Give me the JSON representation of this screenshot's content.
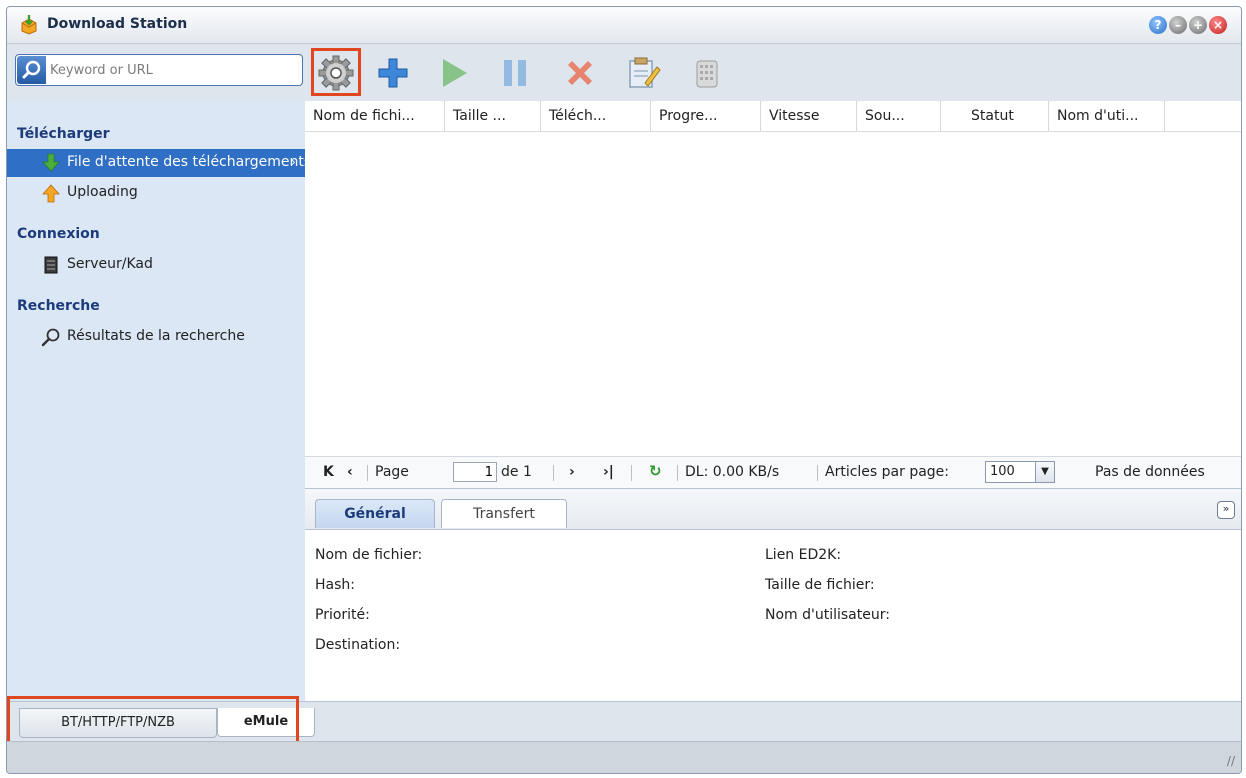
{
  "window": {
    "title": "Download Station",
    "controls": [
      "help-icon",
      "minimize-icon",
      "maximize-icon",
      "close-icon"
    ]
  },
  "search": {
    "placeholder": "Keyword or URL"
  },
  "toolbar": {
    "buttons": [
      "settings-gear-icon",
      "add-icon",
      "resume-icon",
      "pause-icon",
      "delete-icon",
      "edit-icon",
      "clear-icon"
    ]
  },
  "sidebar": {
    "sections": [
      {
        "title": "Télécharger",
        "items": [
          "File d'attente des téléchargements",
          "Uploading"
        ]
      },
      {
        "title": "Connexion",
        "items": [
          "Serveur/Kad"
        ]
      },
      {
        "title": "Recherche",
        "items": [
          "Résultats de la recherche"
        ]
      }
    ]
  },
  "grid": {
    "columns": [
      "Nom de fichi...",
      "Taille ...",
      "Téléch...",
      "Progre...",
      "Vitesse",
      "Sou...",
      "Statut",
      "Nom d'uti..."
    ]
  },
  "pager": {
    "page_label": "Page",
    "page_value": "1",
    "of_label": "de 1",
    "dl_speed": "DL: 0.00 KB/s",
    "per_page_label": "Articles par page:",
    "per_page_value": "100",
    "no_data": "Pas de données"
  },
  "details": {
    "tabs": [
      "Général",
      "Transfert"
    ],
    "left_fields": [
      "Nom de fichier:",
      "Hash:",
      "Priorité:",
      "Destination:"
    ],
    "right_fields": [
      "Lien ED2K:",
      "Taille de fichier:",
      "Nom d'utilisateur:"
    ]
  },
  "bottom_tabs": [
    "BT/HTTP/FTP/NZB",
    "eMule"
  ],
  "colors": {
    "highlight": "#e0461f",
    "selection": "#2f6fc5",
    "accent": "#1c3b7a"
  }
}
